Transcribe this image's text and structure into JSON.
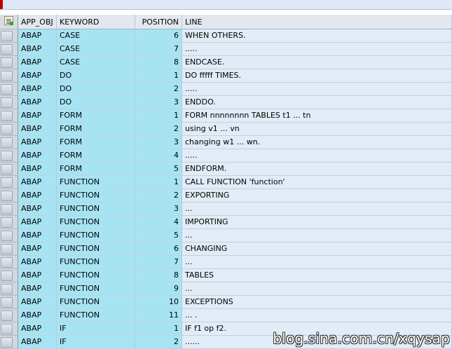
{
  "columns": {
    "app_obj": "APP_OBJ",
    "keyword": "KEYWORD",
    "position": "POSITION",
    "line": "LINE"
  },
  "rows": [
    {
      "app_obj": "ABAP",
      "keyword": "CASE",
      "position": "6",
      "line": "WHEN OTHERS."
    },
    {
      "app_obj": "ABAP",
      "keyword": "CASE",
      "position": "7",
      "line": "....."
    },
    {
      "app_obj": "ABAP",
      "keyword": "CASE",
      "position": "8",
      "line": "ENDCASE."
    },
    {
      "app_obj": "ABAP",
      "keyword": "DO",
      "position": "1",
      "line": "DO fffff TIMES."
    },
    {
      "app_obj": "ABAP",
      "keyword": "DO",
      "position": "2",
      "line": "....."
    },
    {
      "app_obj": "ABAP",
      "keyword": "DO",
      "position": "3",
      "line": "ENDDO."
    },
    {
      "app_obj": "ABAP",
      "keyword": "FORM",
      "position": "1",
      "line": "FORM nnnnnnnn TABLES t1 ... tn"
    },
    {
      "app_obj": "ABAP",
      "keyword": "FORM",
      "position": "2",
      "line": "using  v1 ... vn"
    },
    {
      "app_obj": "ABAP",
      "keyword": "FORM",
      "position": "3",
      "line": "changing w1 ... wn."
    },
    {
      "app_obj": "ABAP",
      "keyword": "FORM",
      "position": "4",
      "line": "....."
    },
    {
      "app_obj": "ABAP",
      "keyword": "FORM",
      "position": "5",
      "line": "ENDFORM."
    },
    {
      "app_obj": "ABAP",
      "keyword": "FUNCTION",
      "position": "1",
      "line": "CALL FUNCTION 'function'"
    },
    {
      "app_obj": "ABAP",
      "keyword": "FUNCTION",
      "position": "2",
      "line": "EXPORTING"
    },
    {
      "app_obj": "ABAP",
      "keyword": "FUNCTION",
      "position": "3",
      "line": "..."
    },
    {
      "app_obj": "ABAP",
      "keyword": "FUNCTION",
      "position": "4",
      "line": "IMPORTING"
    },
    {
      "app_obj": "ABAP",
      "keyword": "FUNCTION",
      "position": "5",
      "line": "..."
    },
    {
      "app_obj": "ABAP",
      "keyword": "FUNCTION",
      "position": "6",
      "line": "CHANGING"
    },
    {
      "app_obj": "ABAP",
      "keyword": "FUNCTION",
      "position": "7",
      "line": "..."
    },
    {
      "app_obj": "ABAP",
      "keyword": "FUNCTION",
      "position": "8",
      "line": "TABLES"
    },
    {
      "app_obj": "ABAP",
      "keyword": "FUNCTION",
      "position": "9",
      "line": "..."
    },
    {
      "app_obj": "ABAP",
      "keyword": "FUNCTION",
      "position": "10",
      "line": "EXCEPTIONS"
    },
    {
      "app_obj": "ABAP",
      "keyword": "FUNCTION",
      "position": "11",
      "line": "...              ."
    },
    {
      "app_obj": "ABAP",
      "keyword": "IF",
      "position": "1",
      "line": "IF f1 op f2."
    },
    {
      "app_obj": "ABAP",
      "keyword": "IF",
      "position": "2",
      "line": "......"
    }
  ],
  "watermark": "blog.sina.com.cn/xqysap",
  "colors": {
    "key_columns": "#a7e4f3",
    "line_column": "#e1ecf7",
    "header": "#e3e8ef"
  },
  "icons": {
    "select_all": "select-all-icon",
    "row_selector": "row-selector-button"
  }
}
